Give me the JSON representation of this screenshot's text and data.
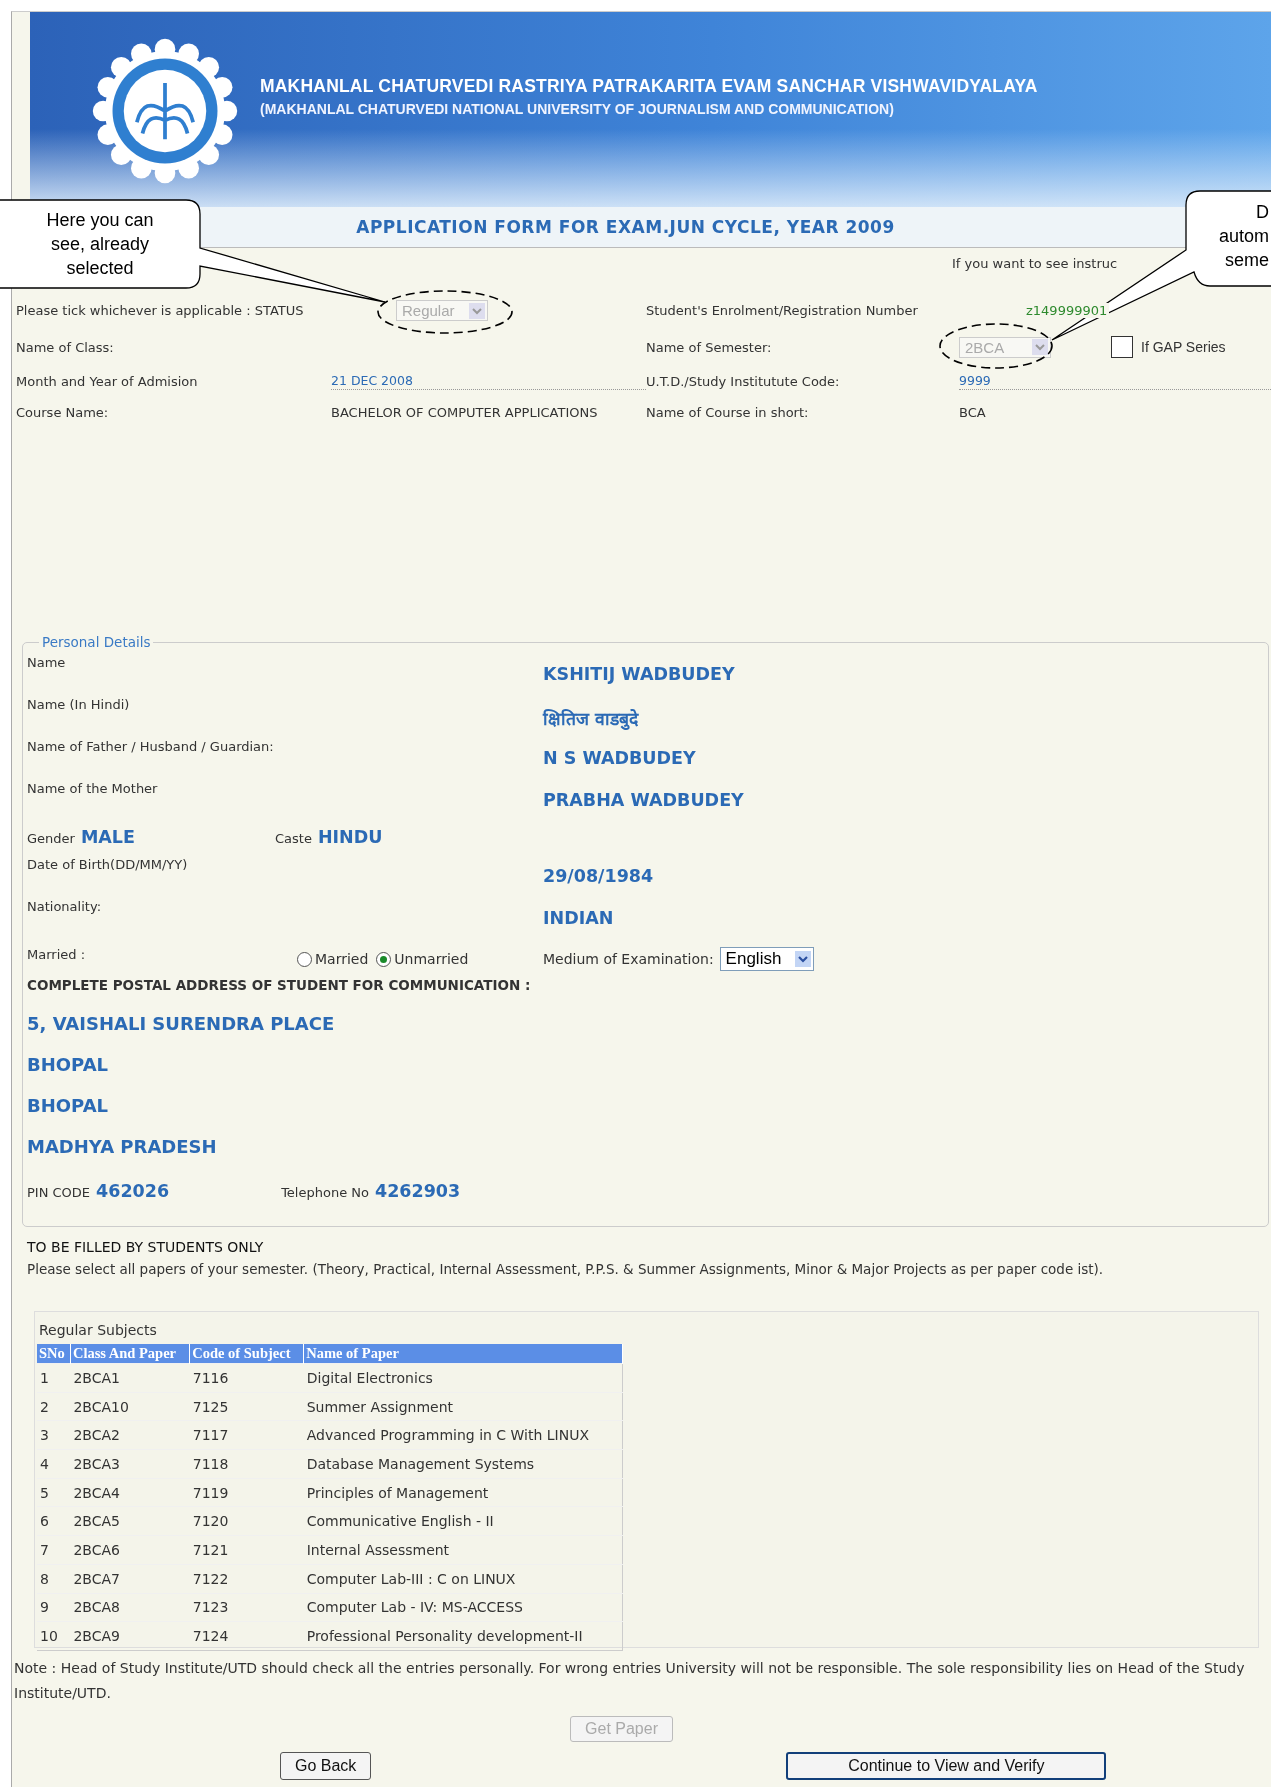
{
  "header": {
    "title": "MAKHANLAL CHATURVEDI RASTRIYA PATRAKARITA EVAM SANCHAR VISHWAVIDYALAYA",
    "subtitle": "(MAKHANLAL CHATURVEDI NATIONAL UNIVERSITY OF JOURNALISM AND COMMUNICATION)"
  },
  "form_title": "APPLICATION FORM FOR EXAM.JUN CYCLE, YEAR 2009",
  "instruction_link": "If you want to see instruc",
  "callouts": [
    {
      "lines": [
        "Here you can",
        "see, already",
        "selected"
      ]
    },
    {
      "lines": [
        "D",
        "autom",
        "seme"
      ]
    }
  ],
  "course_info": {
    "status": {
      "label": "Please tick whichever is applicable : STATUS",
      "value": "Regular",
      "disabled": true
    },
    "enrolment": {
      "label": "Student's Enrolment/Registration Number",
      "value": "z149999901"
    },
    "class": {
      "label": "Name of Class:"
    },
    "semester": {
      "label": "Name of Semester:",
      "value": "2BCA",
      "disabled": true
    },
    "gap_series": {
      "label": "If GAP Series",
      "checked": false
    },
    "admission": {
      "label": "Month and Year of Admision",
      "value": "21 DEC 2008"
    },
    "institute_code": {
      "label": "U.T.D./Study Institutute Code:",
      "value": "9999"
    },
    "course_name": {
      "label": "Course Name:",
      "value": "BACHELOR OF COMPUTER APPLICATIONS"
    },
    "course_short": {
      "label": "Name of Course in short:",
      "value": "BCA"
    }
  },
  "personal_details": {
    "legend": "Personal Details",
    "rows": [
      {
        "label": "Name",
        "value": "KSHITIJ WADBUDEY"
      },
      {
        "label": "Name (In Hindi)",
        "value": "क्षितिज वाडबुदे"
      },
      {
        "label": "Name of Father / Husband / Guardian:",
        "value": "N S WADBUDEY"
      },
      {
        "label": "Name of the Mother",
        "value": "PRABHA WADBUDEY"
      }
    ],
    "gender": {
      "label": "Gender",
      "value": "MALE"
    },
    "caste": {
      "label": "Caste",
      "value": "HINDU"
    },
    "rows2": [
      {
        "label": "Date of Birth(DD/MM/YY)",
        "value": "29/08/1984"
      },
      {
        "label": "Nationality:",
        "value": "INDIAN"
      }
    ],
    "married": {
      "label": "Married :",
      "options": [
        {
          "label": "Married",
          "selected": false
        },
        {
          "label": "Unmarried",
          "selected": true
        }
      ]
    },
    "medium": {
      "label": "Medium of Examination:",
      "value": "English"
    },
    "address_heading": "COMPLETE POSTAL ADDRESS OF STUDENT FOR COMMUNICATION :",
    "address_lines": [
      "5, VAISHALI SURENDRA PLACE",
      "BHOPAL",
      "BHOPAL",
      "MADHYA PRADESH"
    ],
    "pin": {
      "label": "PIN CODE",
      "value": "462026"
    },
    "telephone": {
      "label": "Telephone No",
      "value": "4262903"
    }
  },
  "students_only": {
    "heading": "TO BE FILLED BY STUDENTS ONLY",
    "text": "Please select all papers of your semester. (Theory, Practical, Internal Assessment, P.P.S. & Summer Assignments, Minor & Major Projects as per paper code ist)."
  },
  "subjects": {
    "caption": "Regular Subjects",
    "columns": [
      "SNo",
      "Class And Paper",
      "Code of Subject",
      "Name of Paper"
    ],
    "rows": [
      [
        "1",
        "2BCA1",
        "7116",
        "Digital Electronics"
      ],
      [
        "2",
        "2BCA10",
        "7125",
        "Summer Assignment"
      ],
      [
        "3",
        "2BCA2",
        "7117",
        "Advanced Programming in C With LINUX"
      ],
      [
        "4",
        "2BCA3",
        "7118",
        "Database Management Systems"
      ],
      [
        "5",
        "2BCA4",
        "7119",
        "Principles of Management"
      ],
      [
        "6",
        "2BCA5",
        "7120",
        "Communicative English - II"
      ],
      [
        "7",
        "2BCA6",
        "7121",
        "Internal Assessment"
      ],
      [
        "8",
        "2BCA7",
        "7122",
        "Computer Lab-III : C on LINUX"
      ],
      [
        "9",
        "2BCA8",
        "7123",
        "Computer Lab - IV: MS-ACCESS"
      ],
      [
        "10",
        "2BCA9",
        "7124",
        "Professional Personality development-II"
      ]
    ]
  },
  "note": "Note : Head of Study Institute/UTD should check all the entries personally. For wrong entries University will not be responsible. The sole responsibility lies on Head of the Study Institute/UTD.",
  "buttons": [
    {
      "label": "Get Paper",
      "disabled": true
    },
    {
      "label": "Go Back",
      "disabled": false
    },
    {
      "label": "Continue to View and Verify",
      "disabled": false
    }
  ]
}
